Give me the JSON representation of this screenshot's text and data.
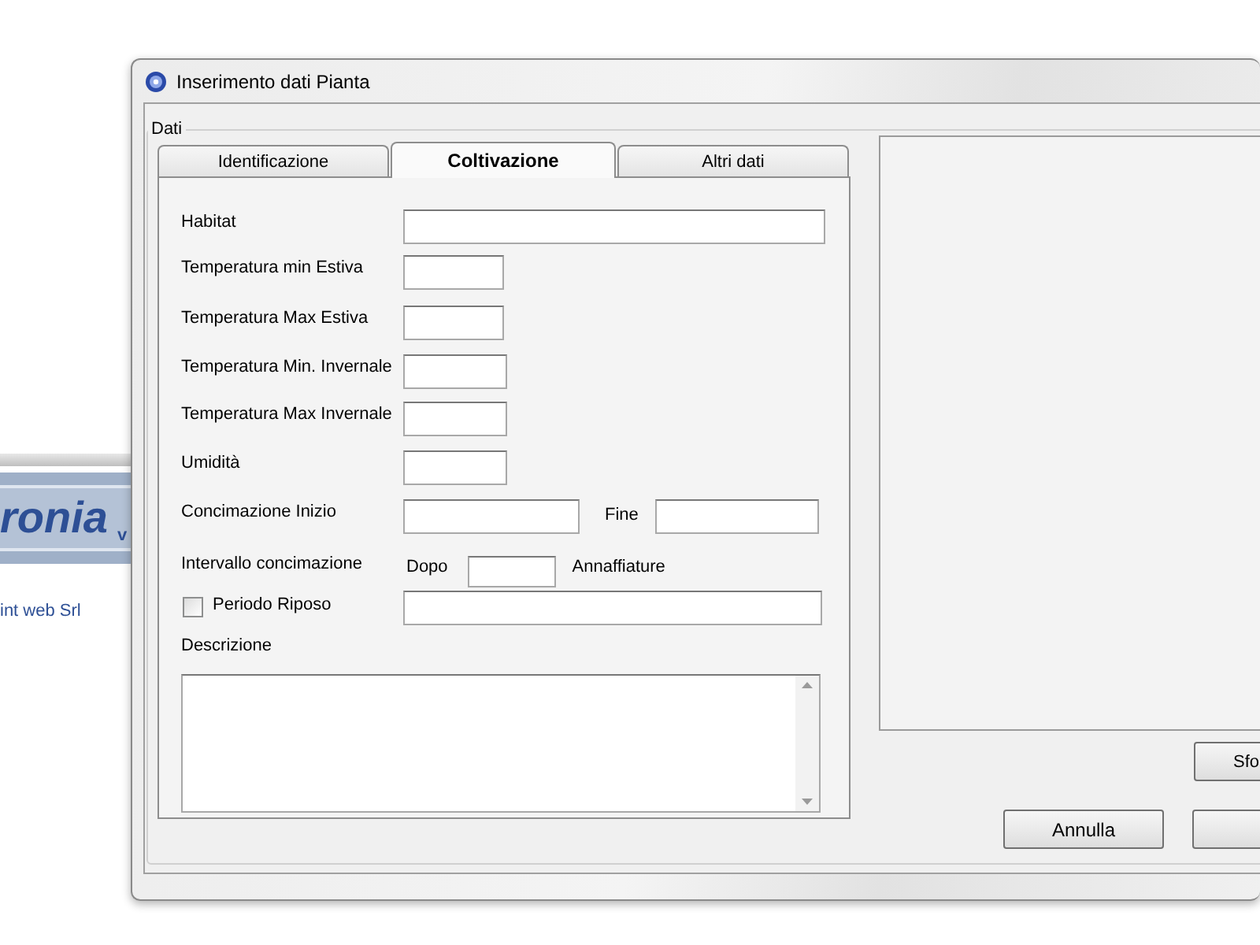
{
  "background_app": {
    "logo_text": "ronia",
    "logo_suffix": "v",
    "company": "int web Srl"
  },
  "window": {
    "title": "Inserimento dati Pianta"
  },
  "group": {
    "label": "Dati"
  },
  "tabs": [
    {
      "label": "Identificazione",
      "selected": false
    },
    {
      "label": "Coltivazione",
      "selected": true
    },
    {
      "label": "Altri dati",
      "selected": false
    }
  ],
  "fields": [
    {
      "kind": "text",
      "label": "Habitat"
    },
    {
      "kind": "text",
      "label": "Temperatura min Estiva"
    },
    {
      "kind": "text",
      "label": "Temperatura Max Estiva"
    },
    {
      "kind": "text",
      "label": "Temperatura Min. Invernale"
    },
    {
      "kind": "text",
      "label": "Temperatura Max Invernale"
    },
    {
      "kind": "text",
      "label": "Umidità"
    },
    {
      "kind": "range",
      "label": "Concimazione  Inizio",
      "second_label": "Fine"
    },
    {
      "kind": "interval",
      "label": "Intervallo concimazione",
      "before": "Dopo",
      "after": "Annaffiature"
    },
    {
      "kind": "checkbox",
      "label": "Periodo Riposo",
      "checked": false
    },
    {
      "kind": "caption",
      "label": "Descrizione"
    },
    {
      "kind": "textarea"
    }
  ],
  "side_button": {
    "label": "Sfo"
  },
  "buttons": [
    {
      "label": "Annulla"
    }
  ],
  "edge_button_visible": true
}
